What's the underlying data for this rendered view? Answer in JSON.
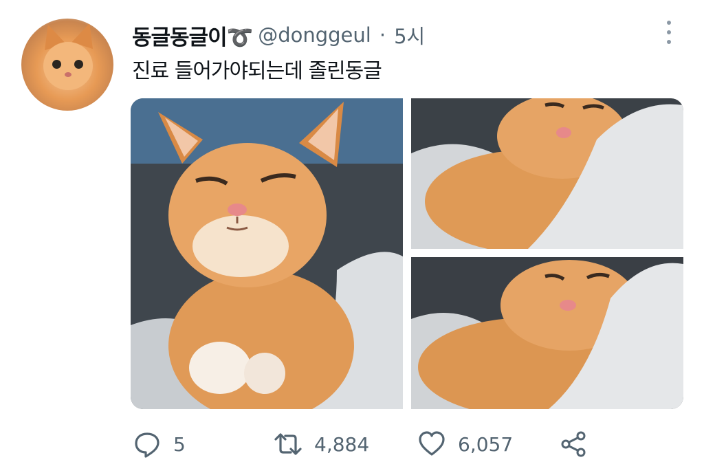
{
  "tweet": {
    "author_name": "동글동글이➰",
    "handle": "@donggeul",
    "separator": "·",
    "time": "5시",
    "text": "진료 들어가야되는데 졸린동글",
    "images": [
      {
        "alt": "orange-kitten-sleepy-sitting-blanket"
      },
      {
        "alt": "orange-kitten-sleeping-blanket"
      },
      {
        "alt": "orange-kitten-sleeping-blanket-closeup"
      }
    ]
  },
  "actions": {
    "reply_count": "5",
    "retweet_count": "4,884",
    "like_count": "6,057"
  },
  "colors": {
    "text": "#0f1419",
    "secondary": "#536471",
    "kitten_orange": "#e3944c",
    "blanket": "#d6d9dc"
  },
  "icons": [
    "more-icon",
    "reply-icon",
    "retweet-icon",
    "like-icon",
    "share-icon"
  ]
}
